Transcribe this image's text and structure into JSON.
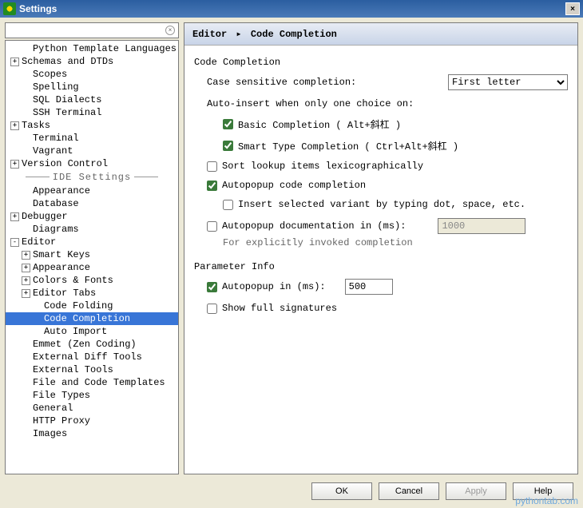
{
  "window": {
    "title": "Settings",
    "close": "×"
  },
  "search": {
    "placeholder": "",
    "clear": "×"
  },
  "tree": {
    "items": [
      {
        "indent": 1,
        "expand": "",
        "label": "Python Template Languages"
      },
      {
        "indent": 0,
        "expand": "+",
        "label": "Schemas and DTDs"
      },
      {
        "indent": 1,
        "expand": "",
        "label": "Scopes"
      },
      {
        "indent": 1,
        "expand": "",
        "label": "Spelling"
      },
      {
        "indent": 1,
        "expand": "",
        "label": "SQL Dialects"
      },
      {
        "indent": 1,
        "expand": "",
        "label": "SSH Terminal"
      },
      {
        "indent": 0,
        "expand": "+",
        "label": "Tasks"
      },
      {
        "indent": 1,
        "expand": "",
        "label": "Terminal"
      },
      {
        "indent": 1,
        "expand": "",
        "label": "Vagrant"
      },
      {
        "indent": 0,
        "expand": "+",
        "label": "Version Control"
      }
    ],
    "section": "IDE Settings",
    "items2": [
      {
        "indent": 1,
        "expand": "",
        "label": "Appearance"
      },
      {
        "indent": 1,
        "expand": "",
        "label": "Database"
      },
      {
        "indent": 0,
        "expand": "+",
        "label": "Debugger"
      },
      {
        "indent": 1,
        "expand": "",
        "label": "Diagrams"
      },
      {
        "indent": 0,
        "expand": "-",
        "label": "Editor"
      },
      {
        "indent": 1,
        "expand": "+",
        "label": "Smart Keys"
      },
      {
        "indent": 1,
        "expand": "+",
        "label": "Appearance"
      },
      {
        "indent": 1,
        "expand": "+",
        "label": "Colors & Fonts"
      },
      {
        "indent": 1,
        "expand": "+",
        "label": "Editor Tabs"
      },
      {
        "indent": 2,
        "expand": "",
        "label": "Code Folding"
      },
      {
        "indent": 2,
        "expand": "",
        "label": "Code Completion",
        "selected": true
      },
      {
        "indent": 2,
        "expand": "",
        "label": "Auto Import"
      },
      {
        "indent": 1,
        "expand": "",
        "label": "Emmet (Zen Coding)"
      },
      {
        "indent": 1,
        "expand": "",
        "label": "External Diff Tools"
      },
      {
        "indent": 1,
        "expand": "",
        "label": "External Tools"
      },
      {
        "indent": 1,
        "expand": "",
        "label": "File and Code Templates"
      },
      {
        "indent": 1,
        "expand": "",
        "label": "File Types"
      },
      {
        "indent": 1,
        "expand": "",
        "label": "General"
      },
      {
        "indent": 1,
        "expand": "",
        "label": "HTTP Proxy"
      },
      {
        "indent": 1,
        "expand": "",
        "label": "Images"
      }
    ]
  },
  "breadcrumb": {
    "root": "Editor",
    "leaf": "Code Completion"
  },
  "groups": {
    "codeCompletion": {
      "title": "Code Completion",
      "caseSensitive": {
        "label": "Case sensitive completion:",
        "value": "First letter"
      },
      "autoInsert": {
        "label": "Auto-insert when only one choice on:"
      },
      "basic": {
        "checked": true,
        "label": "Basic Completion ( Alt+斜杠 )"
      },
      "smart": {
        "checked": true,
        "label": "Smart Type Completion ( Ctrl+Alt+斜杠 )"
      },
      "sortLex": {
        "checked": false,
        "label": "Sort lookup items lexicographically"
      },
      "autopopup": {
        "checked": true,
        "label": "Autopopup code completion"
      },
      "insertVariant": {
        "checked": false,
        "label": "Insert selected variant by typing dot, space, etc."
      },
      "autodoc": {
        "checked": false,
        "label": "Autopopup documentation in (ms):",
        "value": "1000",
        "note": "For explicitly invoked completion"
      }
    },
    "paramInfo": {
      "title": "Parameter Info",
      "autoIn": {
        "checked": true,
        "label": "Autopopup in (ms):",
        "value": "500"
      },
      "fullSig": {
        "checked": false,
        "label": "Show full signatures"
      }
    }
  },
  "buttons": {
    "ok": "OK",
    "cancel": "Cancel",
    "apply": "Apply",
    "help": "Help"
  },
  "watermark": "pythontab.com"
}
